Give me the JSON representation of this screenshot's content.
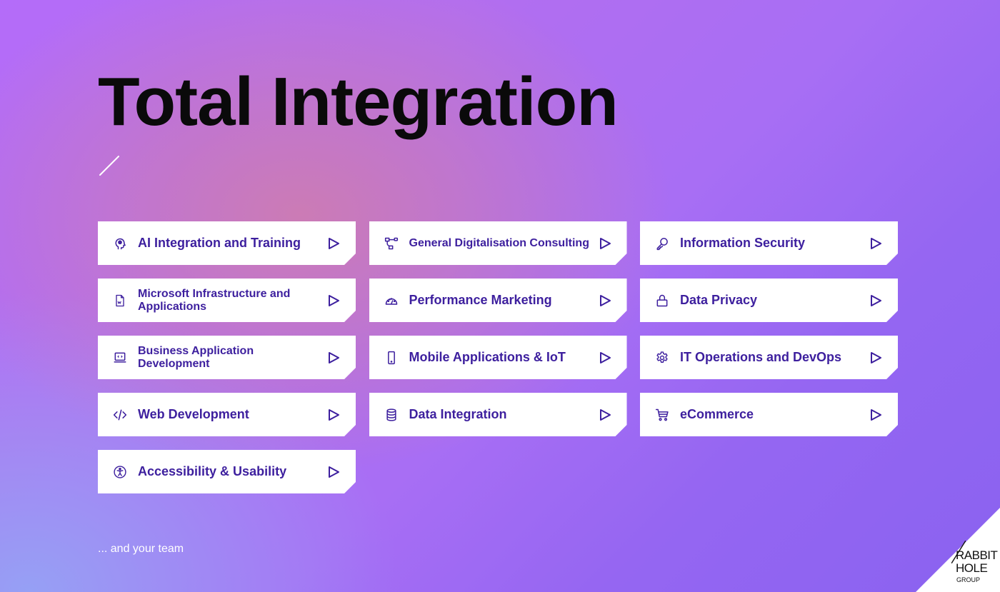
{
  "page": {
    "title": "Total Integration",
    "footer_note": "... and your team"
  },
  "colors": {
    "accent": "#3d1f9e",
    "title": "#0a0a0a",
    "card_bg": "#ffffff",
    "bg_top": "#b46cf9",
    "bg_pink": "#cd7cb2",
    "bg_bottom_right": "#8a62f0",
    "bg_bottom_left": "#96a0f5"
  },
  "services": [
    {
      "label": "AI Integration and Training",
      "icon": "brain-head-icon"
    },
    {
      "label": "General Digitalisation Consulting",
      "icon": "workflow-icon"
    },
    {
      "label": "Information Security",
      "icon": "key-icon"
    },
    {
      "label": "Microsoft Infrastructure and Applications",
      "icon": "word-document-icon"
    },
    {
      "label": "Performance Marketing",
      "icon": "gauge-icon"
    },
    {
      "label": "Data Privacy",
      "icon": "lock-icon"
    },
    {
      "label": "Business Application Development",
      "icon": "laptop-code-icon"
    },
    {
      "label": "Mobile Applications & IoT",
      "icon": "smartphone-icon"
    },
    {
      "label": "IT Operations and DevOps",
      "icon": "gear-icon"
    },
    {
      "label": "Web Development",
      "icon": "code-icon"
    },
    {
      "label": "Data Integration",
      "icon": "database-icon"
    },
    {
      "label": "eCommerce",
      "icon": "shopping-cart-icon"
    },
    {
      "label": "Accessibility & Usability",
      "icon": "accessibility-icon"
    }
  ],
  "logo": {
    "line1": "RABBIT",
    "line2": "HOLE",
    "line3": "GROUP"
  }
}
